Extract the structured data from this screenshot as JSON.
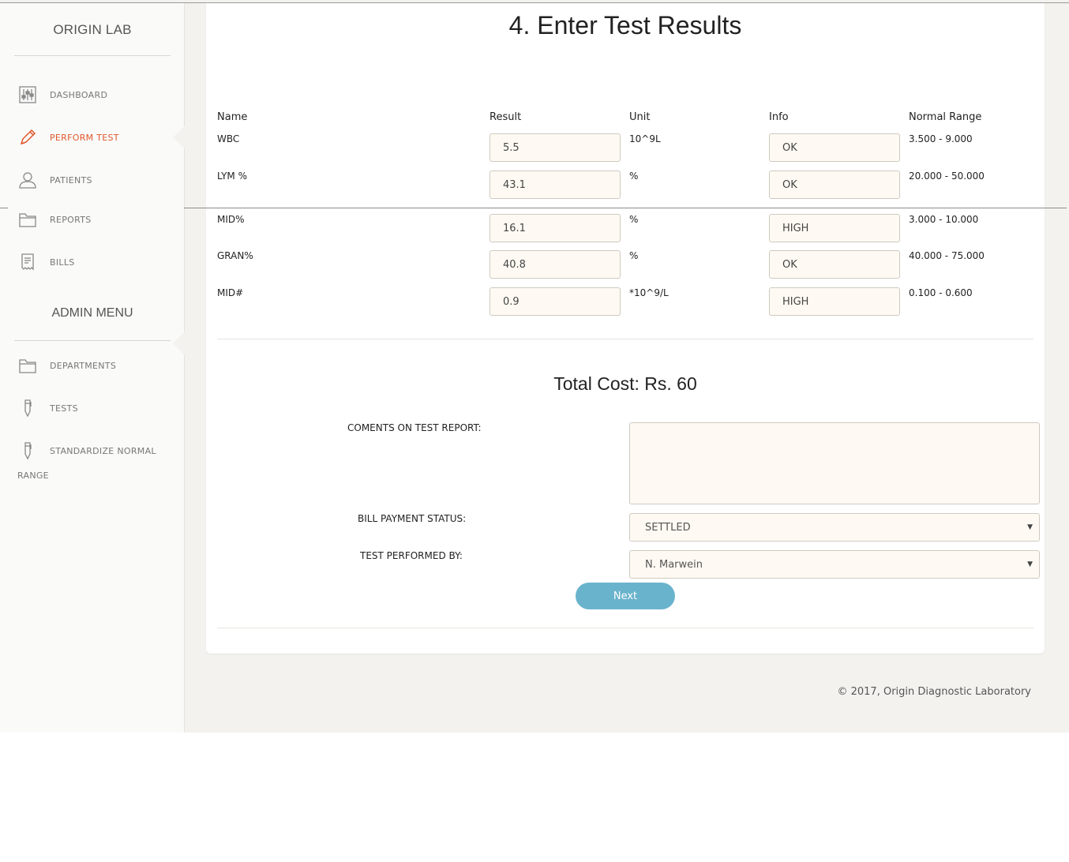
{
  "sidebar": {
    "brand": "ORIGIN LAB",
    "items": [
      {
        "label": "DASHBOARD",
        "icon": "sliders-icon"
      },
      {
        "label": "PERFORM TEST",
        "icon": "pencil-icon",
        "active": true
      },
      {
        "label": "PATIENTS",
        "icon": "user-icon"
      },
      {
        "label": "REPORTS",
        "icon": "folder-icon"
      },
      {
        "label": "BILLS",
        "icon": "receipt-icon"
      }
    ],
    "admin_heading": "ADMIN MENU",
    "admin_items": [
      {
        "label": "DEPARTMENTS",
        "icon": "folder-icon"
      },
      {
        "label": "TESTS",
        "icon": "pen-icon"
      },
      {
        "label": "STANDARDIZE NORMAL",
        "icon": "pen-icon"
      }
    ],
    "admin_item_wrap": "RANGE"
  },
  "page": {
    "title": "4. Enter Test Results"
  },
  "table": {
    "headers": [
      "Name",
      "Result",
      "Unit",
      "Info",
      "Normal Range"
    ],
    "rows": [
      {
        "name": "WBC",
        "result": "5.5",
        "unit": "10^9L",
        "info": "OK",
        "range": "3.500 - 9.000"
      },
      {
        "name": "LYM %",
        "result": "43.1",
        "unit": "%",
        "info": "OK",
        "range": "20.000 - 50.000"
      },
      {
        "name": "MID%",
        "result": "16.1",
        "unit": "%",
        "info": "HIGH",
        "range": "3.000 - 10.000"
      },
      {
        "name": "GRAN%",
        "result": "40.8",
        "unit": "%",
        "info": "OK",
        "range": "40.000 - 75.000"
      },
      {
        "name": "MID#",
        "result": "0.9",
        "unit": "*10^9/L",
        "info": "HIGH",
        "range": "0.100 - 0.600"
      }
    ]
  },
  "summary": {
    "total_cost": "Total Cost: Rs. 60"
  },
  "form": {
    "comments_label": "COMENTS ON TEST REPORT:",
    "comments_value": "",
    "payment_label": "BILL PAYMENT STATUS:",
    "payment_value": "SETTLED",
    "performed_label": "TEST PERFORMED BY:",
    "performed_value": "N. Marwein",
    "next_label": "Next"
  },
  "footer": {
    "text": "© 2017, Origin Diagnostic Laboratory"
  },
  "colors": {
    "accent": "#e0572a",
    "button": "#6ab3cc",
    "input_bg": "#fefaf3"
  }
}
